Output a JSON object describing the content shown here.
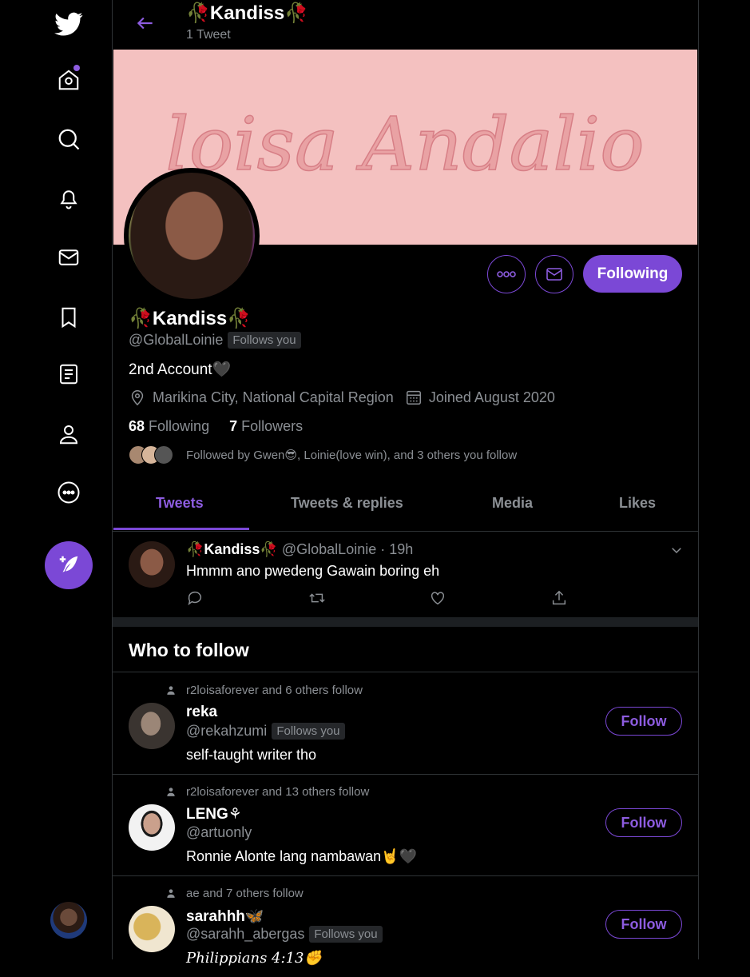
{
  "colors": {
    "accent": "#7b48d6",
    "accent_text": "#8d5ce0",
    "muted": "#8b8f94",
    "banner": "#f4c1c0"
  },
  "sidebar": {
    "icons": [
      "twitter-logo-icon",
      "home-icon",
      "explore-icon",
      "notifications-icon",
      "messages-icon",
      "bookmarks-icon",
      "lists-icon",
      "profile-icon",
      "more-icon",
      "compose-icon"
    ]
  },
  "header": {
    "name": "🥀Kandiss🥀",
    "tweet_count": "1 Tweet"
  },
  "banner": {
    "text": "loisa Andalio"
  },
  "profile": {
    "name": "🥀Kandiss🥀",
    "handle": "@GlobalLoinie",
    "follows_you": "Follows you",
    "bio": "2nd Account🖤",
    "location": "Marikina City, National Capital Region",
    "joined": "Joined August 2020",
    "following_count": "68",
    "following_label": "Following",
    "followers_count": "7",
    "followers_label": "Followers",
    "followed_by": "Followed by Gwen😎, Loinie(love win), and 3 others you follow",
    "following_button": "Following"
  },
  "tabs": [
    "Tweets",
    "Tweets & replies",
    "Media",
    "Likes"
  ],
  "tweet": {
    "name": "🥀Kandiss🥀",
    "handle": "@GlobalLoinie",
    "time": "· 19h",
    "text": "Hmmm ano pwedeng Gawain boring eh"
  },
  "who_to_follow": {
    "title": "Who to follow",
    "follow_label": "Follow",
    "items": [
      {
        "context": "r2loisaforever and 6 others follow",
        "name": "reka",
        "handle": "@rekahzumi",
        "badge": "Follows you",
        "bio": "self-taught writer tho"
      },
      {
        "context": "r2loisaforever and 13 others follow",
        "name": "LENG⚘",
        "handle": "@artuonly",
        "badge": "",
        "bio": "Ronnie Alonte lang nambawan🤘🖤"
      },
      {
        "context": "ae and 7 others follow",
        "name": "sarahhh🦋",
        "handle": "@sarahh_abergas",
        "badge": "Follows you",
        "bio": "Philippians 4:13✊"
      }
    ]
  }
}
